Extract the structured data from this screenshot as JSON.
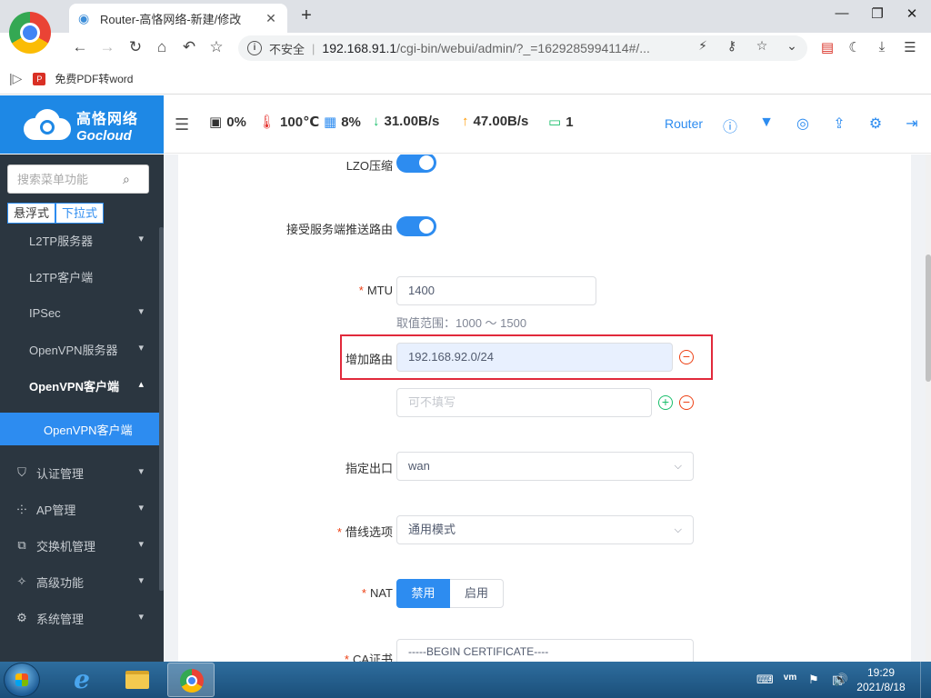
{
  "browser": {
    "tab_title": "Router-高恪网络-新建/修改",
    "insecure_label": "不安全",
    "url_host": "192.168.91.1",
    "url_path": "/cgi-bin/webui/admin/?_=1629285994114#/...",
    "bookmark_label": "免费PDF转word"
  },
  "header": {
    "logo_cn": "高恪网络",
    "logo_en": "Gocloud",
    "stats": {
      "cpu": "0%",
      "temp": "100℃",
      "mem": "8%",
      "down": "31.00B/s",
      "up": "47.00B/s",
      "clients": "1"
    },
    "router_label": "Router"
  },
  "sidebar": {
    "search_placeholder": "搜索菜单功能",
    "mode_float": "悬浮式",
    "mode_dropdown": "下拉式",
    "items": [
      {
        "label": "L2TP服务器"
      },
      {
        "label": "L2TP客户端"
      },
      {
        "label": "IPSec"
      },
      {
        "label": "OpenVPN服务器"
      },
      {
        "label": "OpenVPN客户端"
      },
      {
        "label": "OpenVPN客户端"
      },
      {
        "label": "认证管理"
      },
      {
        "label": "AP管理"
      },
      {
        "label": "交换机管理"
      },
      {
        "label": "高级功能"
      },
      {
        "label": "系统管理"
      }
    ]
  },
  "form": {
    "lzo_label": "LZO压缩",
    "accept_routes_label": "接受服务端推送路由",
    "mtu_label": "MTU",
    "mtu_value": "1400",
    "mtu_hint": "取值范围：1000 ～ 1500",
    "add_route_label": "增加路由",
    "route_value": "192.168.92.0/24",
    "route_placeholder": "可不填写",
    "egress_label": "指定出口",
    "egress_value": "wan",
    "line_option_label": "借线选项",
    "line_option_value": "通用模式",
    "nat_label": "NAT",
    "nat_disable": "禁用",
    "nat_enable": "启用",
    "ca_label": "CA证书",
    "ca_value": "-----BEGIN CERTIFICATE----"
  },
  "taskbar": {
    "time": "19:29",
    "date": "2021/8/18"
  }
}
